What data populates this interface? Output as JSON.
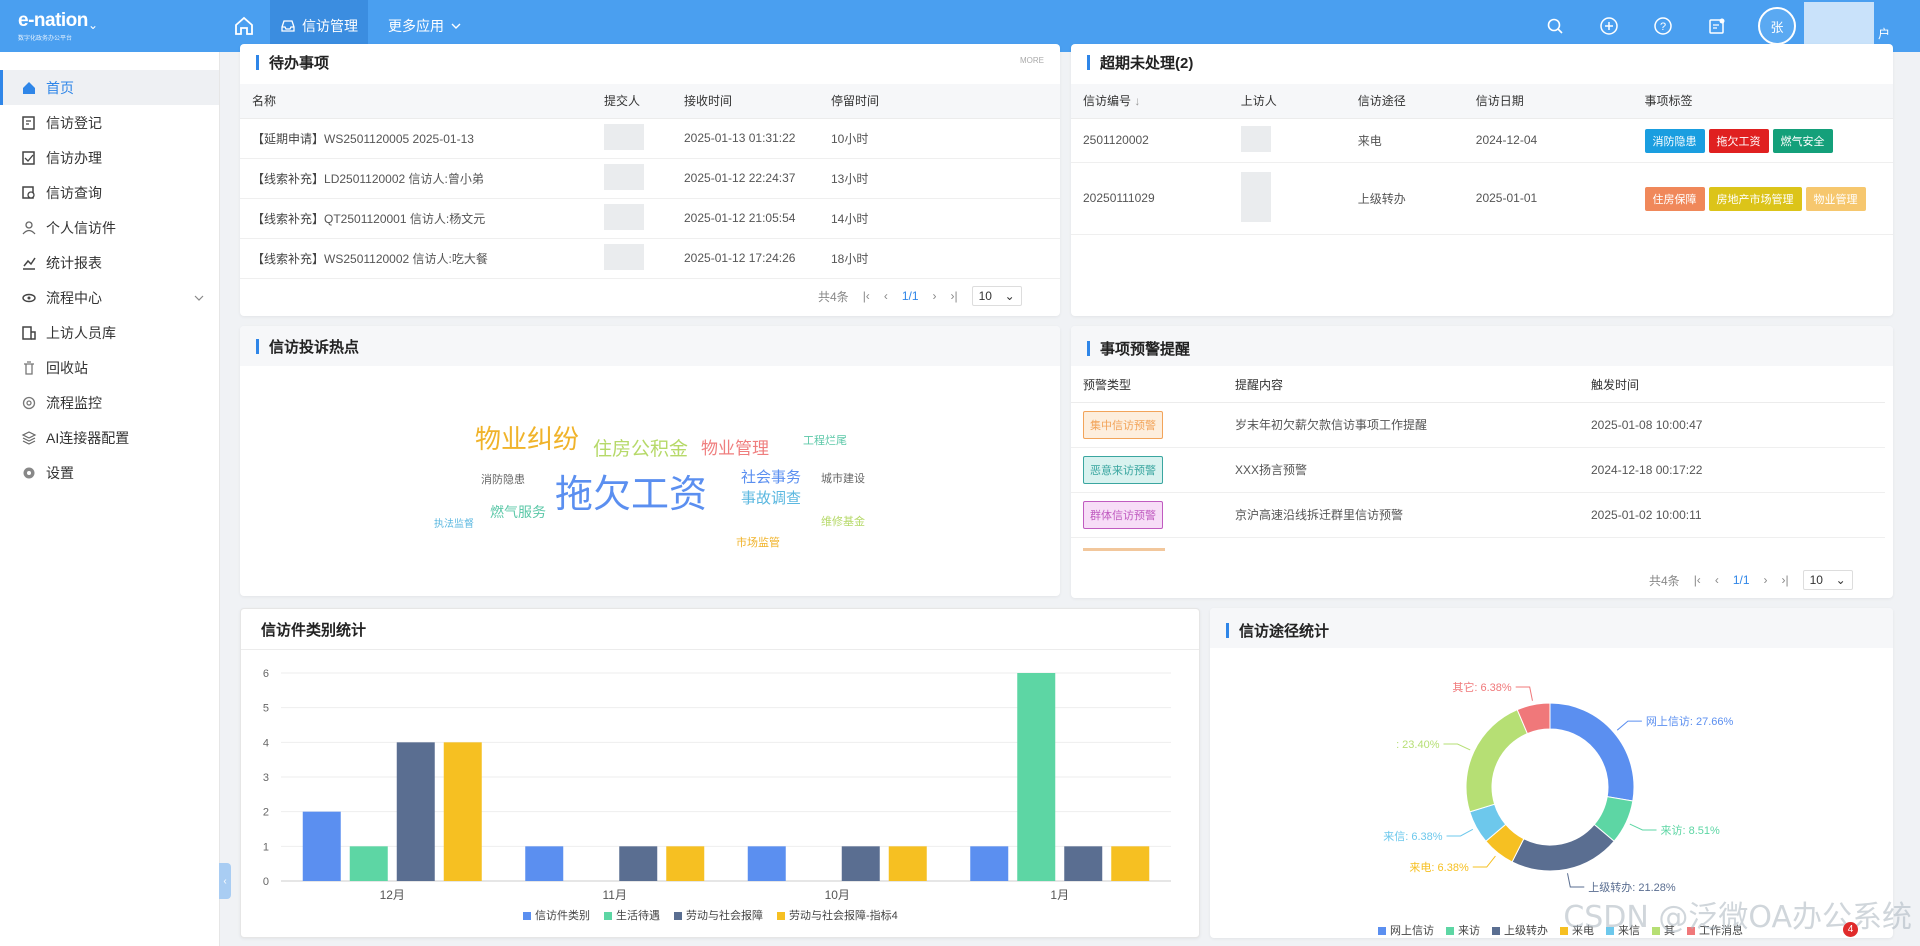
{
  "topbar": {
    "logo": "e-nation",
    "logo_sub": "数字化政务办公平台",
    "active_tab": "信访管理",
    "more_apps": "更多应用",
    "avatar_text": "张",
    "user_tail": "户"
  },
  "sidebar": {
    "items": [
      {
        "label": "首页",
        "icon": "home-icon"
      },
      {
        "label": "信访登记",
        "icon": "register-icon"
      },
      {
        "label": "信访办理",
        "icon": "handle-icon"
      },
      {
        "label": "信访查询",
        "icon": "query-icon"
      },
      {
        "label": "个人信访件",
        "icon": "person-icon"
      },
      {
        "label": "统计报表",
        "icon": "chart-icon"
      },
      {
        "label": "流程中心",
        "icon": "flow-icon"
      },
      {
        "label": "上访人员库",
        "icon": "people-icon"
      },
      {
        "label": "回收站",
        "icon": "trash-icon"
      },
      {
        "label": "流程监控",
        "icon": "monitor-icon"
      },
      {
        "label": "AI连接器配置",
        "icon": "ai-icon"
      },
      {
        "label": "设置",
        "icon": "settings-icon"
      }
    ]
  },
  "todo": {
    "title": "待办事项",
    "more": "MORE",
    "headers": [
      "名称",
      "提交人",
      "接收时间",
      "停留时间"
    ],
    "rows": [
      {
        "tag": "【延期申请】",
        "name": "WS2501120005 2025-01-13",
        "time": "2025-01-13 01:31:22",
        "stay": "10小时"
      },
      {
        "tag": "【线索补充】",
        "name": "LD2501120002 信访人:曾小弟",
        "time": "2025-01-12 22:24:37",
        "stay": "13小时"
      },
      {
        "tag": "【线索补充】",
        "name": "QT2501120001 信访人:杨文元",
        "time": "2025-01-12 21:05:54",
        "stay": "14小时"
      },
      {
        "tag": "【线索补充】",
        "name": "WS2501120002 信访人:吃大餐",
        "time": "2025-01-12 17:24:26",
        "stay": "18小时"
      }
    ],
    "pager": {
      "total": "共4条",
      "page": "1/1",
      "size": "10"
    }
  },
  "overdue": {
    "title": "超期未处理(2)",
    "headers": [
      "信访编号",
      "上访人",
      "信访途径",
      "信访日期",
      "事项标签"
    ],
    "sort_arrow": "↓",
    "rows": [
      {
        "id": "2501120002",
        "channel": "来电",
        "date": "2024-12-04",
        "tags": [
          {
            "text": "消防隐患",
            "color": "#1a9ee0"
          },
          {
            "text": "拖欠工资",
            "color": "#e02020"
          },
          {
            "text": "燃气安全",
            "color": "#14a07a"
          }
        ]
      },
      {
        "id": "20250111029",
        "channel": "上级转办",
        "date": "2025-01-01",
        "tags": [
          {
            "text": "住房保障",
            "color": "#f0885a"
          },
          {
            "text": "房地产市场管理",
            "color": "#dcc419"
          },
          {
            "text": "物业管理",
            "color": "#f6c76e"
          }
        ]
      }
    ]
  },
  "hotspot": {
    "title": "信访投诉热点",
    "words": [
      {
        "text": "物业纠纷",
        "color": "#f0b32a"
      },
      {
        "text": "住房公积金",
        "color": "#b6d969"
      },
      {
        "text": "物业管理",
        "color": "#ef7e7e"
      },
      {
        "text": "工程烂尾",
        "color": "#5cc8a8"
      },
      {
        "text": "消防隐患",
        "color": "#666666"
      },
      {
        "text": "拖欠工资",
        "color": "#5b8ff0"
      },
      {
        "text": "社会事务",
        "color": "#5b8ff0"
      },
      {
        "text": "城市建设",
        "color": "#666666"
      },
      {
        "text": "燃气服务",
        "color": "#5cc8a8"
      },
      {
        "text": "事故调查",
        "color": "#5cb8e0"
      },
      {
        "text": "执法监督",
        "color": "#5cb8e0"
      },
      {
        "text": "维修基金",
        "color": "#b6d969"
      },
      {
        "text": "市场监管",
        "color": "#f0b32a"
      }
    ]
  },
  "warning": {
    "title": "事项预警提醒",
    "headers": [
      "预警类型",
      "提醒内容",
      "触发时间"
    ],
    "rows": [
      {
        "type": "集中信访预警",
        "content": "岁末年初欠薪欠款信访事项工作提醒",
        "time": "2025-01-08 10:00:47",
        "fg": "#f2a45a",
        "bg": "#fdeedd"
      },
      {
        "type": "恶意来访预警",
        "content": "XXX扬言预警",
        "time": "2024-12-18 00:17:22",
        "fg": "#3aa6a0",
        "bg": "#d8f2ef"
      },
      {
        "type": "群体信访预警",
        "content": "京沪高速沿线拆迁群里信访预警",
        "time": "2025-01-02 10:00:11",
        "fg": "#c05bc0",
        "bg": "#f7ddf7"
      }
    ],
    "pager": {
      "total": "共4条",
      "page": "1/1",
      "size": "10"
    }
  },
  "category_chart": {
    "title": "信访件类别统计"
  },
  "channel_chart": {
    "title": "信访途径统计"
  },
  "chart_data": [
    {
      "type": "bar",
      "categories": [
        "12月",
        "11月",
        "10月",
        "1月"
      ],
      "ylim": [
        0,
        6
      ],
      "yticks": [
        0,
        1,
        2,
        3,
        4,
        5,
        6
      ],
      "series": [
        {
          "name": "信访件类别",
          "color": "#5b8ff0",
          "values": [
            2,
            1,
            1,
            1
          ]
        },
        {
          "name": "生活待遇",
          "color": "#5dd6a4",
          "values": [
            1,
            0,
            0,
            6
          ]
        },
        {
          "name": "劳动与社会报障",
          "color": "#5a6e91",
          "values": [
            4,
            1,
            1,
            1
          ]
        },
        {
          "name": "劳动与社会报障-指标4",
          "color": "#f6c022",
          "values": [
            4,
            1,
            1,
            1
          ]
        }
      ]
    },
    {
      "type": "pie",
      "slices": [
        {
          "name": "网上信访",
          "value": 27.66,
          "label": "网上信访: 27.66%",
          "color": "#5b8ff0"
        },
        {
          "name": "来访",
          "value": 8.51,
          "label": "来访: 8.51%",
          "color": "#5dd6a4"
        },
        {
          "name": "上级转办",
          "value": 21.28,
          "label": "上级转办: 21.28%",
          "color": "#5a6e91"
        },
        {
          "name": "来电",
          "value": 6.38,
          "label": "来电: 6.38%",
          "color": "#f6c022"
        },
        {
          "name": "来信",
          "value": 6.38,
          "label": "来信: 6.38%",
          "color": "#6dc8ec"
        },
        {
          "name": "",
          "value": 23.4,
          "label": ": 23.40%",
          "color": "#b6df74"
        },
        {
          "name": "其它",
          "value": 6.38,
          "label": "其它: 6.38%",
          "color": "#f0787a"
        }
      ],
      "legend": [
        "网上信访",
        "来访",
        "上级转办",
        "来电",
        "来信",
        "其",
        "工作消息"
      ]
    }
  ],
  "watermark": "CSDN @泛微OA办公系统",
  "notify_badge": "4"
}
